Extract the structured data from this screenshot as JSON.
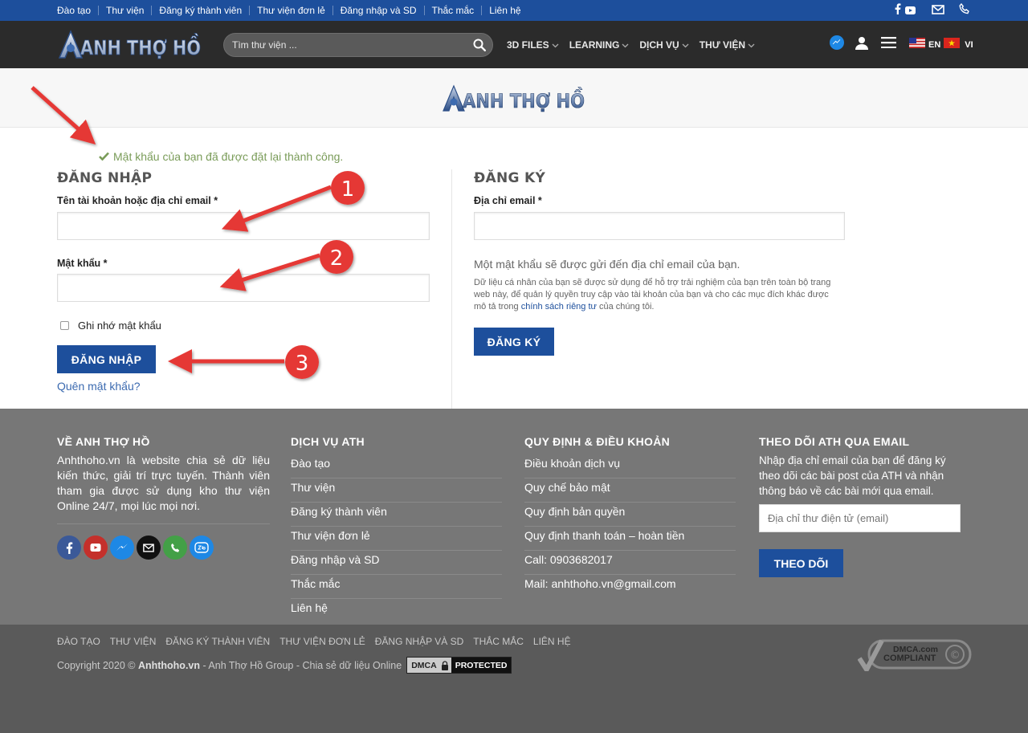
{
  "topbar": {
    "links": [
      "Đào tạo",
      "Thư viện",
      "Đăng ký thành viên",
      "Thư viện đơn lẻ",
      "Đăng nhập và SD",
      "Thắc mắc",
      "Liên hệ"
    ]
  },
  "header": {
    "logo_text": "ANH THỢ HỒ",
    "search_placeholder": "Tìm thư viện ...",
    "nav": [
      "3D FILES",
      "LEARNING",
      "DỊCH VỤ",
      "THƯ VIỆN"
    ],
    "lang_en": "EN",
    "lang_vi": "VI"
  },
  "banner": {
    "logo_text": "ANH THỢ HỒ"
  },
  "login": {
    "success_message": "Mật khẩu của bạn đã được đặt lại thành công.",
    "heading": "ĐĂNG NHẬP",
    "username_label": "Tên tài khoản hoặc địa chỉ email",
    "password_label": "Mật khẩu",
    "required_mark": "*",
    "remember_label": "Ghi nhớ mật khẩu",
    "submit_label": "ĐĂNG NHẬP",
    "forgot_link": "Quên mật khẩu?"
  },
  "register": {
    "heading": "ĐĂNG KÝ",
    "email_label": "Địa chỉ email",
    "required_mark": "*",
    "password_note": "Một mật khẩu sẽ được gửi đến địa chỉ email của bạn.",
    "privacy_text_before": "Dữ liệu cá nhân của bạn sẽ được sử dụng để hỗ trợ trải nghiệm của bạn trên toàn bộ trang web này, để quản lý quyền truy cập vào tài khoản của bạn và cho các mục đích khác được mô tả trong ",
    "privacy_link": "chính sách riêng tư",
    "privacy_text_after": " của chúng tôi.",
    "submit_label": "ĐĂNG KÝ"
  },
  "annotations": [
    "1",
    "2",
    "3"
  ],
  "footer": {
    "about": {
      "heading": "VỀ ANH THỢ HỒ",
      "text": "Anhthoho.vn là website chia sẻ dữ liệu kiến thức, giải trí trực tuyến. Thành viên tham gia được sử dụng kho thư viện Online 24/7, mọi lúc mọi nơi."
    },
    "services": {
      "heading": "DỊCH VỤ ATH",
      "items": [
        "Đào tạo",
        "Thư viện",
        "Đăng ký thành viên",
        "Thư viện đơn lẻ",
        "Đăng nhập và SD",
        "Thắc mắc",
        "Liên hệ"
      ]
    },
    "policies": {
      "heading": "QUY ĐỊNH & ĐIỀU KHOẢN",
      "items": [
        "Điều khoản dịch vụ",
        "Quy chế bảo mật",
        "Quy định bản quyền",
        "Quy định thanh toán – hoàn tiền",
        "Call: 0903682017",
        "Mail: anhthoho.vn@gmail.com"
      ]
    },
    "subscribe": {
      "heading": "THEO DÕI ATH QUA EMAIL",
      "text": "Nhập địa chỉ email của bạn để đăng ký theo dõi các bài post của ATH và nhận thông báo về các bài mới qua email.",
      "placeholder": "Địa chỉ thư điện tử (email)",
      "button": "THEO DÕI"
    }
  },
  "bottom": {
    "links": [
      "ĐÀO TẠO",
      "THƯ VIỆN",
      "ĐĂNG KÝ THÀNH VIÊN",
      "THƯ VIỆN ĐƠN LẺ",
      "ĐĂNG NHẬP VÀ SD",
      "THẮC MẮC",
      "LIÊN HỆ"
    ],
    "copyright_prefix": "Copyright 2020 © ",
    "copyright_site": "Anhthoho.vn",
    "copyright_suffix": " - Anh Thợ Hồ Group - Chia sẻ dữ liệu Online",
    "dmca_badge_left": "DMCA",
    "dmca_badge_right": "PROTECTED",
    "dmca_compliant_top": "DMCA.com",
    "dmca_compliant_bottom": "COMPLIANT"
  },
  "colors": {
    "brand_blue": "#1d4f9c",
    "header_dark": "#2b2b2b",
    "footer_gray": "#777777",
    "success_green": "#7a9c59",
    "arrow_red": "#e53935"
  }
}
